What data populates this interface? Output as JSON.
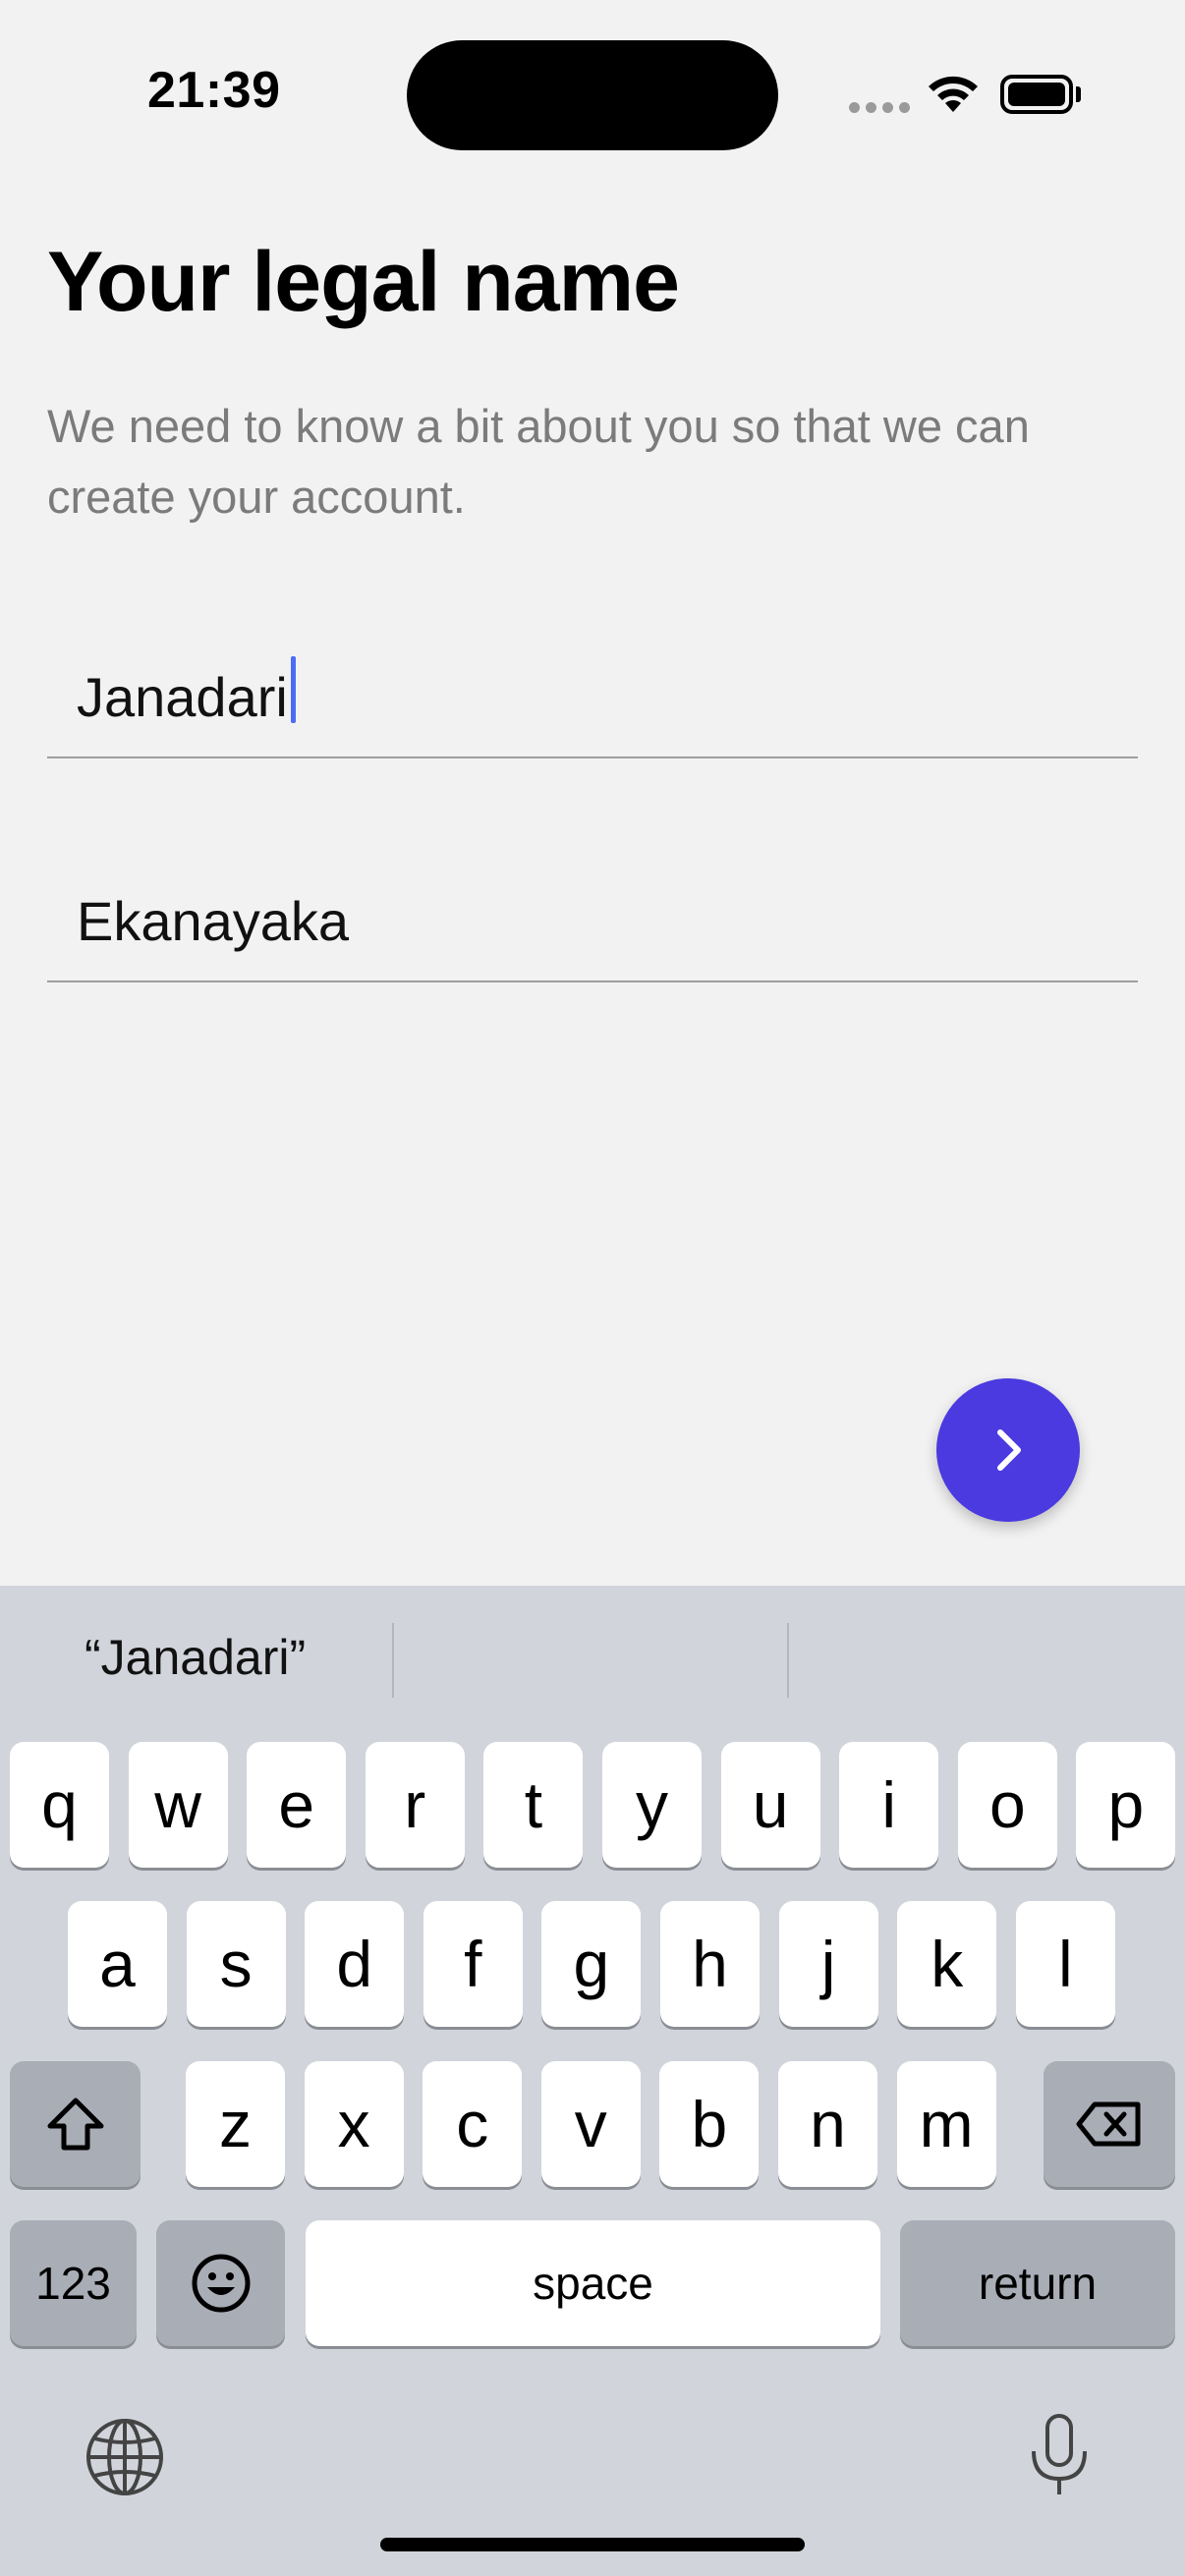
{
  "status_bar": {
    "time": "21:39"
  },
  "page": {
    "title": "Your legal name",
    "subtitle": "We need to know a bit about you so that we can create your account."
  },
  "form": {
    "first_name_value": "Janadari",
    "last_name_value": "Ekanayaka"
  },
  "next_button": {
    "icon": "chevron-right-icon",
    "color": "#4a3ae0"
  },
  "keyboard": {
    "suggestion_1": "“Janadari”",
    "row1": [
      "q",
      "w",
      "e",
      "r",
      "t",
      "y",
      "u",
      "i",
      "o",
      "p"
    ],
    "row2": [
      "a",
      "s",
      "d",
      "f",
      "g",
      "h",
      "j",
      "k",
      "l"
    ],
    "row3": [
      "z",
      "x",
      "c",
      "v",
      "b",
      "n",
      "m"
    ],
    "numbers_label": "123",
    "space_label": "space",
    "return_label": "return"
  }
}
